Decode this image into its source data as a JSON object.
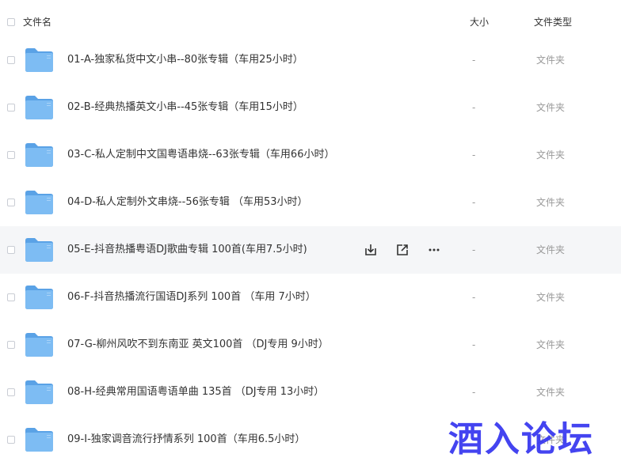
{
  "header": {
    "name_label": "文件名",
    "size_label": "大小",
    "type_label": "文件类型"
  },
  "files": [
    {
      "name": "01-A-独家私货中文小串--80张专辑（车用25小时）",
      "size": "-",
      "type": "文件夹"
    },
    {
      "name": "02-B-经典热播英文小串--45张专辑（车用15小时）",
      "size": "-",
      "type": "文件夹"
    },
    {
      "name": "03-C-私人定制中文国粤语串烧--63张专辑（车用66小时）",
      "size": "-",
      "type": "文件夹"
    },
    {
      "name": "04-D-私人定制外文串烧--56张专辑 （车用53小时）",
      "size": "-",
      "type": "文件夹"
    },
    {
      "name": "05-E-抖音热播粤语DJ歌曲专辑 100首(车用7.5小时)",
      "size": "-",
      "type": "文件夹"
    },
    {
      "name": "06-F-抖音热播流行国语DJ系列 100首 （车用 7小时）",
      "size": "-",
      "type": "文件夹"
    },
    {
      "name": "07-G-柳州风吹不到东南亚 英文100首 （DJ专用 9小时）",
      "size": "-",
      "type": "文件夹"
    },
    {
      "name": "08-H-经典常用国语粤语单曲 135首 （DJ专用 13小时）",
      "size": "-",
      "type": "文件夹"
    },
    {
      "name": "09-I-独家调音流行抒情系列 100首（车用6.5小时）",
      "size": "-",
      "type": "文件夹"
    }
  ],
  "hover_row_actions": [
    "download-icon",
    "share-icon",
    "more-icon"
  ],
  "watermark": "酒入论坛",
  "colors": {
    "folder": "#6fb3f0",
    "folder_dark": "#5aa2e6",
    "hover_bg": "#f5f6f8",
    "watermark": "#3a3af0"
  }
}
